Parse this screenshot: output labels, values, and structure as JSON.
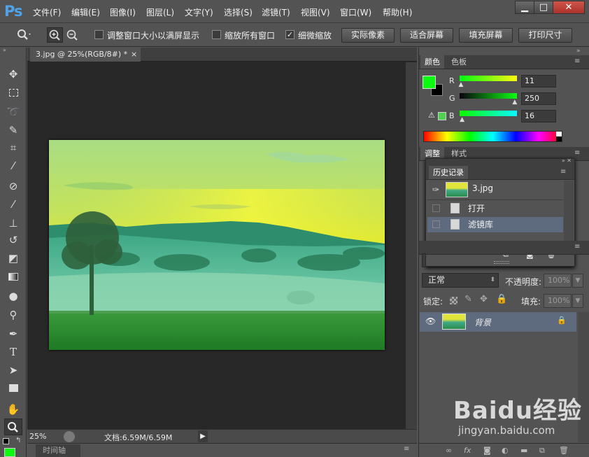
{
  "app": {
    "logo": "Ps"
  },
  "menu": [
    "文件(F)",
    "编辑(E)",
    "图像(I)",
    "图层(L)",
    "文字(Y)",
    "选择(S)",
    "滤镜(T)",
    "视图(V)",
    "窗口(W)",
    "帮助(H)"
  ],
  "window_controls": {
    "minimize": "▁",
    "maximize": "□",
    "close": "✕"
  },
  "options": {
    "resize_windows_label": "调整窗口大小以满屏显示",
    "zoom_all_label": "缩放所有窗口",
    "scrubby_zoom_label": "细微缩放",
    "actual_pixels": "实际像素",
    "fit_screen": "适合屏幕",
    "fill_screen": "填充屏幕",
    "print_size": "打印尺寸"
  },
  "document": {
    "tab_title": "3.jpg @ 25%(RGB/8#) *",
    "tab_close": "×"
  },
  "status": {
    "zoom": "25%",
    "doc_info": "文档:6.59M/6.59M"
  },
  "timeline": {
    "label": "时间轴"
  },
  "color_panel": {
    "tabs": [
      "颜色",
      "色板"
    ],
    "r_label": "R",
    "g_label": "G",
    "b_label": "B",
    "r_value": "11",
    "g_value": "250",
    "b_value": "16",
    "r_fraction": 0.043,
    "g_fraction": 0.98,
    "b_fraction": 0.063,
    "foreground_color": "#0bfa10",
    "background_color": "#000000"
  },
  "adjust_panel": {
    "tabs": [
      "调整",
      "样式"
    ]
  },
  "history_panel": {
    "title": "历史记录",
    "snapshot": "3.jpg",
    "states": [
      "打开",
      "滤镜库"
    ]
  },
  "layers_panel": {
    "blend_mode": "正常",
    "opacity_label": "不透明度:",
    "opacity_value": "100%",
    "lock_label": "锁定:",
    "fill_label": "填充:",
    "fill_value": "100%",
    "layer_name": "背景"
  },
  "watermark": {
    "brand": "Baidu经验",
    "url": "jingyan.baidu.com"
  }
}
